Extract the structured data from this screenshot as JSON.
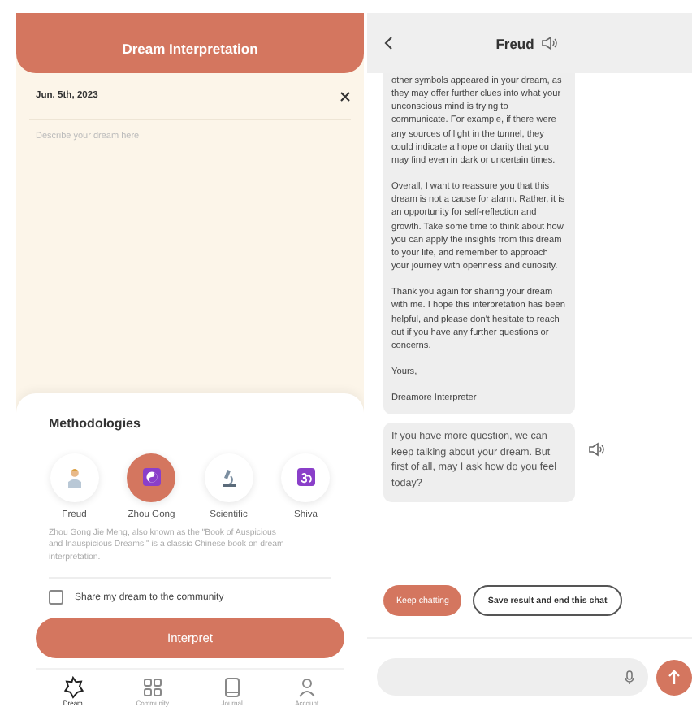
{
  "dream_screen": {
    "header": {
      "title": "Dream Interpretation"
    },
    "entry": {
      "date": "Jun. 5th, 2023",
      "placeholder": "Describe your dream here"
    },
    "methodologies": {
      "title": "Methodologies",
      "items": [
        {
          "label": "Freud",
          "kind": "doctor",
          "selected": false
        },
        {
          "label": "Zhou Gong",
          "kind": "yinyang",
          "selected": true
        },
        {
          "label": "Scientific",
          "kind": "microscope",
          "selected": false
        },
        {
          "label": "Shiva",
          "kind": "om",
          "selected": false
        }
      ],
      "description": "Zhou Gong Jie Meng, also known as the \"Book of Auspicious and Inauspicious Dreams,\" is a classic Chinese book on dream interpretation.",
      "share": {
        "label": "Share my dream to the community",
        "checked": false
      },
      "button": "Interpret"
    },
    "nav": [
      {
        "label": "Dream",
        "kind": "dream",
        "selected": true
      },
      {
        "label": "Community",
        "kind": "community",
        "selected": false
      },
      {
        "label": "Journal",
        "kind": "journal",
        "selected": false
      },
      {
        "label": "Account",
        "kind": "account",
        "selected": false
      }
    ]
  },
  "chat_screen": {
    "header": {
      "title": "Freud"
    },
    "messages": [
      {
        "speaker": false,
        "paragraphs": [
          "other symbols appeared in your dream, as they may offer further clues into what your unconscious mind is trying to communicate. For example, if there were any sources of light in the tunnel, they could indicate a hope or clarity that you may find even in dark or uncertain times.",
          "Overall, I want to reassure you that this dream is not a cause for alarm. Rather, it is an opportunity for self-reflection and growth. Take some time to think about how you can apply the insights from this dream to your life, and remember to approach your journey with openness and curiosity.",
          "Thank you again for sharing your dream with me. I hope this interpretation has been helpful, and please don't hesitate to reach out if you have any further questions or concerns.",
          "Yours,",
          "Dreamore Interpreter"
        ]
      },
      {
        "speaker": true,
        "paragraphs": [
          "If you have more question, we can keep talking about your dream. But first of all, may I ask how do you feel today?"
        ]
      }
    ],
    "actions": [
      {
        "label": "Keep chatting",
        "kind": "primary"
      },
      {
        "label": "Save result and end this chat",
        "kind": "outline"
      }
    ]
  }
}
